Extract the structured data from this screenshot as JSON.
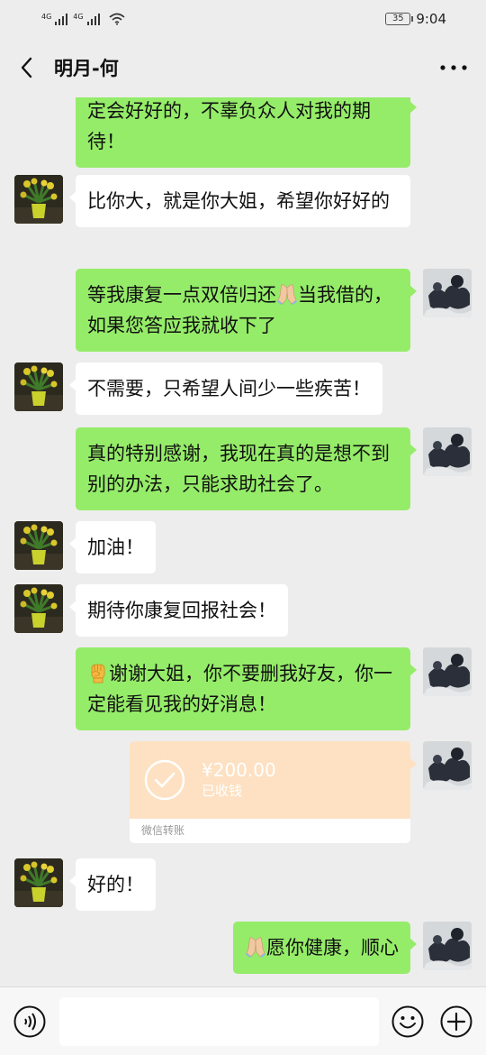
{
  "status_bar": {
    "signal1": "4G",
    "signal2": "4G",
    "battery": "35",
    "time": "9:04"
  },
  "header": {
    "title": "明月-何",
    "back_icon": "chevron-left-icon",
    "more_icon": "more-dots-icon"
  },
  "messages": [
    {
      "side": "right",
      "text": "定会好好的，不辜负众人对我的期待！"
    },
    {
      "side": "left",
      "text": "比你大，就是你大姐，希望你好好的"
    },
    {
      "side": "right",
      "text_before": "等我康复一点双倍归还",
      "emoji": "folded-hands",
      "text_after": "当我借的，如果您答应我就收下了"
    },
    {
      "side": "left",
      "text": "不需要，只希望人间少一些疾苦！"
    },
    {
      "side": "right",
      "text": "真的特别感谢，我现在真的是想不到别的办法，只能求助社会了。"
    },
    {
      "side": "left",
      "text": "加油！"
    },
    {
      "side": "left",
      "text": "期待你康复回报社会！"
    },
    {
      "side": "right",
      "emoji": "raised-fist",
      "text_after": "谢谢大姐，你不要删我好友，你一定能看见我的好消息！"
    },
    {
      "side": "left",
      "text": "好的！"
    },
    {
      "side": "right",
      "emoji": "folded-hands",
      "text_after": "愿你健康，顺心"
    }
  ],
  "transfer": {
    "amount": "¥200.00",
    "status": "已收钱",
    "label": "微信转账"
  },
  "input_bar": {
    "voice_icon": "voice-icon",
    "emoji_icon": "smiley-icon",
    "plus_icon": "plus-circle-icon",
    "placeholder": ""
  },
  "colors": {
    "green_bubble": "#95ec69",
    "white_bubble": "#ffffff",
    "background": "#ededed",
    "transfer": "#fde1c2"
  }
}
